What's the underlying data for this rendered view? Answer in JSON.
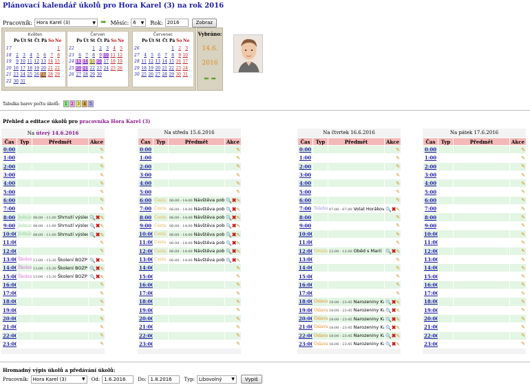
{
  "header": {
    "title": "Plánovací kalendář úkolů pro Hora Karel (3) na rok 2016"
  },
  "filter": {
    "employee_label": "Pracovník:",
    "employee_value": "Hora Karel (3)",
    "month_label": "Měsíc:",
    "month_value": "6",
    "year_label": "Rok:",
    "year_value": "2016",
    "submit_label": "Zobraz"
  },
  "weekdays": [
    "Po",
    "Út",
    "St",
    "Čt",
    "Pá",
    "So",
    "Ne"
  ],
  "calendars": [
    {
      "name": "Květen",
      "start": 6,
      "days": 31,
      "weeks": [
        "17",
        "18",
        "19",
        "20",
        "21",
        "22"
      ]
    },
    {
      "name": "Červen",
      "start": 2,
      "days": 30,
      "weeks": [
        "22",
        "23",
        "24",
        "25",
        "26"
      ]
    },
    {
      "name": "Červenec",
      "start": 4,
      "days": 31,
      "weeks": [
        "26",
        "27",
        "28",
        "29",
        "30"
      ]
    }
  ],
  "selected": {
    "label": "Vybráno:",
    "day": "14.6.",
    "year": "2016"
  },
  "colors": {
    "c1": "#90e890",
    "c2": "#f3a8f3",
    "c3": "#f6f06a",
    "c4": "#e4a84a",
    "c5": "#b4a8f6"
  },
  "legend": {
    "label": "Tabulka barev počtu úkolů:",
    "items": [
      "1",
      "2",
      "3",
      "4",
      "5"
    ]
  },
  "overview": {
    "prefix": "Přehled a editace úkolů pro ",
    "name": "pracovníka Hora Karel (3)"
  },
  "table_headers": {
    "time": "Čas",
    "type": "Typ",
    "subject": "Předmět",
    "actions": "Akce"
  },
  "hours": [
    "0:00",
    "1:00",
    "2:00",
    "3:00",
    "4:00",
    "5:00",
    "6:00",
    "7:00",
    "8:00",
    "9:00",
    "10:00",
    "11:00",
    "12:00",
    "13:00",
    "14:00",
    "15:00",
    "16:00",
    "17:00",
    "18:00",
    "19:00",
    "20:00",
    "21:00",
    "22:00",
    "23:00"
  ],
  "days": [
    {
      "title_prefix": "Na ",
      "title_main": "úterý 14.6.2016",
      "today": true,
      "tasks": {
        "8": {
          "type": "Jednání",
          "cls": "typ-jednani",
          "time": "08:00 - 11:00",
          "title": "Shrnutí výsledků práce oddělení"
        },
        "9": {
          "type": "Jednání",
          "cls": "typ-jednani",
          "time": "08:00 - 11:00",
          "title": "Shrnutí výsledků práce oddělení"
        },
        "10": {
          "type": "Jednání",
          "cls": "typ-jednani",
          "time": "08:00 - 11:00",
          "title": "Shrnutí výsledků práce oddělení"
        },
        "13": {
          "type": "Školení",
          "cls": "typ-skoleni",
          "time": "13:00 - 15:30",
          "title": "Školení BOZP"
        },
        "14": {
          "type": "Školení",
          "cls": "typ-skoleni",
          "time": "13:00 - 15:30",
          "title": "Školení BOZP"
        },
        "15": {
          "type": "Školení",
          "cls": "typ-skoleni",
          "time": "13:00 - 15:30",
          "title": "Školení BOZP"
        }
      }
    },
    {
      "title_prefix": "Na ",
      "title_main": "středu 15.6.2016",
      "today": false,
      "tasks": {
        "6": {
          "type": "Cesta",
          "cls": "typ-cesta",
          "time": "06:00 - 14:00",
          "title": "Návštěva pobo..."
        },
        "7": {
          "type": "Cesta",
          "cls": "typ-cesta",
          "time": "06:00 - 14:00",
          "title": "Návštěva pobo..."
        },
        "8": {
          "type": "Cesta",
          "cls": "typ-cesta",
          "time": "06:00 - 14:00",
          "title": "Návštěva pobo..."
        },
        "9": {
          "type": "Cesta",
          "cls": "typ-cesta",
          "time": "06:00 - 14:00",
          "title": "Návštěva pobo..."
        },
        "10": {
          "type": "Cesta",
          "cls": "typ-cesta",
          "time": "06:00 - 14:00",
          "title": "Návštěva pobo..."
        },
        "11": {
          "type": "Cesta",
          "cls": "typ-cesta",
          "time": "06:00 - 14:00",
          "title": "Návštěva pobo..."
        },
        "12": {
          "type": "Cesta",
          "cls": "typ-cesta",
          "time": "06:00 - 14:00",
          "title": "Návštěva pobo..."
        },
        "13": {
          "type": "Cesta",
          "cls": "typ-cesta",
          "time": "06:00 - 14:00",
          "title": "Návštěva pobo..."
        }
      }
    },
    {
      "title_prefix": "Na ",
      "title_main": "čtvrtek 16.6.2016",
      "today": false,
      "tasks": {
        "7": {
          "type": "Telefon",
          "cls": "typ-telefon",
          "time": "07:00 - 07:00",
          "title": "Volat Horákové"
        },
        "12": {
          "type": "Ostatní",
          "cls": "typ-cesta",
          "time": "12:00 - 12:00",
          "title": "Oběd s Marií"
        },
        "18": {
          "type": "Oslava",
          "cls": "typ-oslava",
          "time": "18:00 - 23:45",
          "title": "Narozeniny Karel"
        },
        "19": {
          "type": "Oslava",
          "cls": "typ-oslava",
          "time": "18:00 - 23:45",
          "title": "Narozeniny Karel"
        },
        "20": {
          "type": "Oslava",
          "cls": "typ-oslava",
          "time": "18:00 - 23:45",
          "title": "Narozeniny Karel"
        },
        "21": {
          "type": "Oslava",
          "cls": "typ-oslava",
          "time": "18:00 - 23:45",
          "title": "Narozeniny Karel"
        },
        "22": {
          "type": "Oslava",
          "cls": "typ-oslava",
          "time": "18:00 - 23:45",
          "title": "Narozeniny Karel"
        },
        "23": {
          "type": "Oslava",
          "cls": "typ-oslava",
          "time": "18:00 - 23:45",
          "title": "Narozeniny Karel"
        }
      }
    },
    {
      "title_prefix": "Na ",
      "title_main": "pátek 17.6.2016",
      "today": false,
      "tasks": {}
    }
  ],
  "bulk": {
    "title": "Hromadný výpis úkolů a předávání úkolů:",
    "employee_label": "Pracovník:",
    "employee_value": "Hora Karel (3)",
    "from_label": "Od:",
    "from_value": "1.6.2016",
    "to_label": "Do:",
    "to_value": "1.8.2016",
    "type_label": "Typ:",
    "type_value": "Libovolný",
    "submit_label": "Vypiš"
  }
}
